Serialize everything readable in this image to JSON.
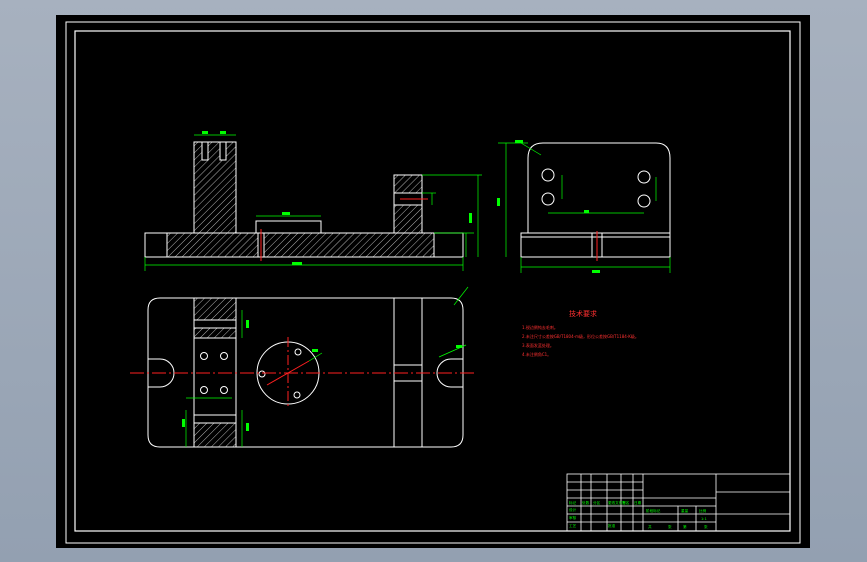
{
  "sheet": {
    "background": "#000000",
    "frame_color": "#ffffff",
    "geometry_color": "#ffffff",
    "dimension_color": "#00ff00",
    "centerline_color": "#ff2020",
    "hatch_color": "#ffffff",
    "hole_color": "#ff2020",
    "title_color": "#ff3030"
  },
  "technical_requirements": {
    "title": "技术要求",
    "lines": [
      "1.锐边倒钝去毛刺。",
      "2.未注尺寸公差按GB/T1804-m级，形位公差按GB/T1184-K级。",
      "3.表面发蓝处理。",
      "4.未注倒角C1。"
    ]
  },
  "title_block": {
    "row_labels": [
      "标记",
      "处数",
      "分区",
      "更改文件号",
      "签名",
      "日期"
    ],
    "role_labels": [
      "设计",
      "审核",
      "工艺",
      "批准"
    ],
    "stage_labels": [
      "阶段标记",
      "重量",
      "比例"
    ],
    "scale": "1:1",
    "sheet_labels": [
      "共",
      "张",
      "第",
      "张"
    ]
  }
}
